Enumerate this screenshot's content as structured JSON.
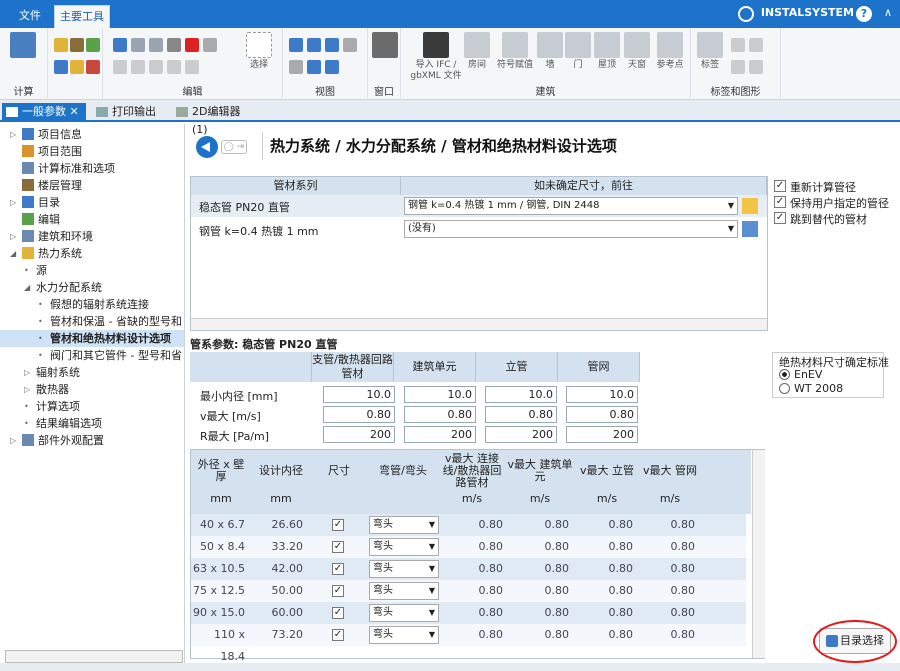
{
  "ribbon": {
    "tab_file": "文件",
    "tab_main": "主要工具",
    "brand": "INSTALSYSTEM",
    "groups": [
      "计算",
      "编辑",
      "视图",
      "窗口",
      "建筑",
      "标签和图形"
    ],
    "big_buttons": [
      "选择",
      "导入 IFC / gbXML 文件",
      "房间",
      "符号赋值",
      "墙",
      "门",
      "屋顶",
      "天窗",
      "参考点",
      "标签"
    ]
  },
  "doc_tabs": [
    "一般参数",
    "打印输出",
    "2D编辑器 (1)"
  ],
  "tree": [
    {
      "label": "项目信息",
      "indent": 0,
      "arrow": "▷"
    },
    {
      "label": "项目范围",
      "indent": 0,
      "arrow": ""
    },
    {
      "label": "计算标准和选项",
      "indent": 0,
      "arrow": ""
    },
    {
      "label": "楼层管理",
      "indent": 0,
      "arrow": ""
    },
    {
      "label": "目录",
      "indent": 0,
      "arrow": "▷"
    },
    {
      "label": "编辑",
      "indent": 0,
      "arrow": ""
    },
    {
      "label": "建筑和环境",
      "indent": 0,
      "arrow": "▷"
    },
    {
      "label": "热力系统",
      "indent": 0,
      "arrow": "◢"
    },
    {
      "label": "源",
      "indent": 1,
      "arrow": "•"
    },
    {
      "label": "水力分配系统",
      "indent": 1,
      "arrow": "◢"
    },
    {
      "label": "假想的辐射系统连接",
      "indent": 2,
      "arrow": "•"
    },
    {
      "label": "管材和保温 - 省缺的型号和",
      "indent": 2,
      "arrow": "•"
    },
    {
      "label": "管材和绝热材料设计选项",
      "indent": 2,
      "arrow": "•",
      "selected": true
    },
    {
      "label": "阀门和其它管件 - 型号和省",
      "indent": 2,
      "arrow": "•"
    },
    {
      "label": "辐射系统",
      "indent": 1,
      "arrow": "▷"
    },
    {
      "label": "散热器",
      "indent": 1,
      "arrow": "▷"
    },
    {
      "label": "计算选项",
      "indent": 1,
      "arrow": "•"
    },
    {
      "label": "结果编辑选项",
      "indent": 1,
      "arrow": "•"
    },
    {
      "label": "部件外观配置",
      "indent": 0,
      "arrow": "▷"
    }
  ],
  "main": {
    "title": "热力系统 / 水力分配系统 / 管材和绝热材料设计选项",
    "grid1": {
      "col1": "管材系列",
      "col2": "如未确定尺寸，前往",
      "rows": [
        {
          "series": "稳态管 PN20 直管",
          "target": "钢管 k=0.4 热镀 1 mm / 钢管, DIN 2448"
        },
        {
          "series": "钢管 k=0.4 热镀 1 mm",
          "target": "(没有)"
        }
      ]
    },
    "options": [
      "重新计算管径",
      "保持用户指定的管径",
      "跳到替代的管材"
    ],
    "params_label": "管系参数: 稳态管 PN20 直管",
    "grid2": {
      "headers": [
        "支管/散热器回路管材",
        "建筑单元",
        "立管",
        "管网"
      ],
      "rows": [
        {
          "label": "最小内径 [mm]",
          "values": [
            "10.0",
            "10.0",
            "10.0",
            "10.0"
          ]
        },
        {
          "label": "v最大 [m/s]",
          "values": [
            "0.80",
            "0.80",
            "0.80",
            "0.80"
          ]
        },
        {
          "label": "R最大 [Pa/m]",
          "values": [
            "200",
            "200",
            "200",
            "200"
          ]
        }
      ]
    },
    "insulation": {
      "title": "绝热材料尺寸确定标准",
      "options": [
        "EnEV",
        "WT 2008"
      ],
      "selected": "EnEV"
    },
    "grid3": {
      "headers": [
        "外径 x 壁厚",
        "设计内径",
        "尺寸",
        "弯管/弯头",
        "v最大 连接线/散热器回路管材",
        "v最大 建筑单元",
        "v最大 立管",
        "v最大 管网"
      ],
      "units": [
        "mm",
        "mm",
        "",
        "",
        "m/s",
        "m/s",
        "m/s",
        "m/s"
      ],
      "rows": [
        {
          "size": "40 x 6.7",
          "inner": "26.60",
          "bend": "弯头",
          "v": [
            "0.80",
            "0.80",
            "0.80",
            "0.80"
          ]
        },
        {
          "size": "50 x 8.4",
          "inner": "33.20",
          "bend": "弯头",
          "v": [
            "0.80",
            "0.80",
            "0.80",
            "0.80"
          ]
        },
        {
          "size": "63 x 10.5",
          "inner": "42.00",
          "bend": "弯头",
          "v": [
            "0.80",
            "0.80",
            "0.80",
            "0.80"
          ]
        },
        {
          "size": "75 x 12.5",
          "inner": "50.00",
          "bend": "弯头",
          "v": [
            "0.80",
            "0.80",
            "0.80",
            "0.80"
          ]
        },
        {
          "size": "90 x 15.0",
          "inner": "60.00",
          "bend": "弯头",
          "v": [
            "0.80",
            "0.80",
            "0.80",
            "0.80"
          ]
        },
        {
          "size": "110 x 18.4",
          "inner": "73.20",
          "bend": "弯头",
          "v": [
            "0.80",
            "0.80",
            "0.80",
            "0.80"
          ]
        }
      ]
    },
    "dir_button": "目录选择"
  }
}
